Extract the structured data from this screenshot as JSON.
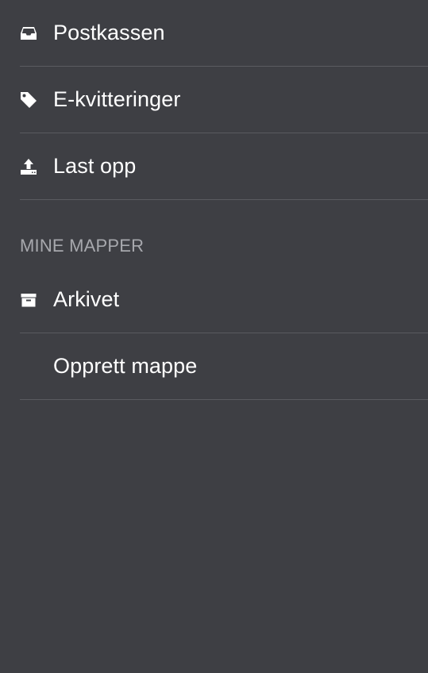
{
  "menu": {
    "items": [
      {
        "label": "Postkassen",
        "icon": "inbox-icon"
      },
      {
        "label": "E-kvitteringer",
        "icon": "tag-icon"
      },
      {
        "label": "Last opp",
        "icon": "upload-icon"
      }
    ],
    "section_title": "MINE MAPPER",
    "folders": [
      {
        "label": "Arkivet",
        "icon": "archive-box-icon"
      },
      {
        "label": "Opprett mappe",
        "icon": ""
      }
    ]
  },
  "colors": {
    "background": "#3e3f44",
    "divider": "#5a5b60",
    "text": "#ffffff",
    "section_text": "#a7a8ad"
  }
}
